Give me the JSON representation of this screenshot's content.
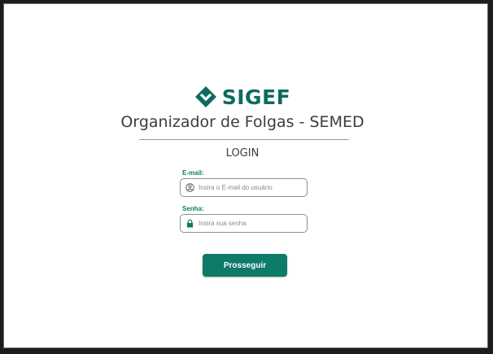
{
  "brand": {
    "logo_text": "SIGEF",
    "logo_icon": "diamond-chevron-icon",
    "color": "#0f6b5f"
  },
  "app_title": "Organizador de Folgas - SEMED",
  "login": {
    "heading": "LOGIN",
    "email": {
      "label": "E-mail:",
      "placeholder": "Insira o E-mail do usuário",
      "value": "",
      "icon": "user-circle-icon"
    },
    "password": {
      "label": "Senha:",
      "placeholder": "Insira sua senha",
      "value": "",
      "icon": "lock-icon"
    },
    "submit_label": "Prosseguir"
  },
  "colors": {
    "accent": "#0e7a68",
    "label": "#0f7a6a",
    "text": "#3d3d3d"
  }
}
